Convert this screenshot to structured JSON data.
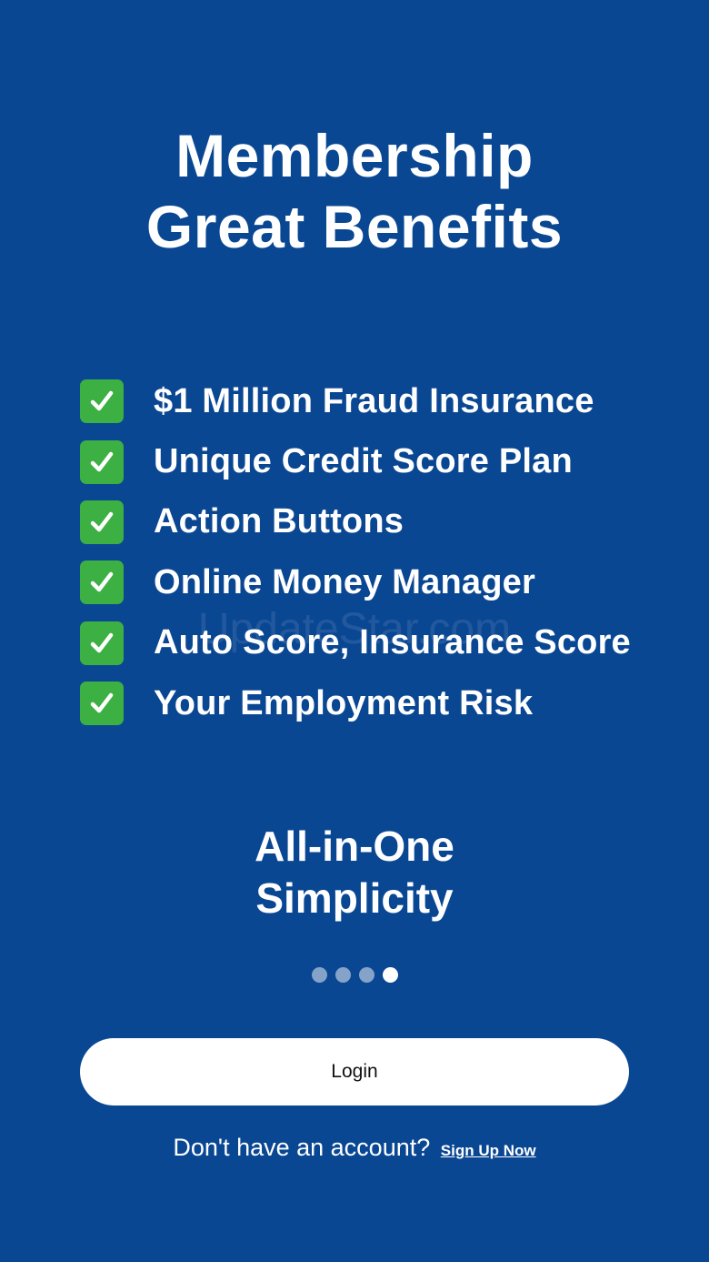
{
  "header": {
    "title_line1": "Membership",
    "title_line2": "Great Benefits"
  },
  "benefits": [
    {
      "label": "$1 Million Fraud Insurance",
      "icon": "check-mark-icon"
    },
    {
      "label": "Unique Credit Score Plan",
      "icon": "check-mark-icon"
    },
    {
      "label": "Action Buttons",
      "icon": "check-mark-icon"
    },
    {
      "label": "Online Money Manager",
      "icon": "check-mark-icon"
    },
    {
      "label": "Auto Score, Insurance Score",
      "icon": "check-mark-icon"
    },
    {
      "label": "Your Employment Risk",
      "icon": "check-mark-icon"
    }
  ],
  "watermark": "UpdateStar.com",
  "tagline": {
    "line1": "All-in-One",
    "line2": "Simplicity"
  },
  "pager": {
    "total": 4,
    "active_index": 3
  },
  "actions": {
    "login_label": "Login",
    "signup_prompt": "Don't have an account?",
    "signup_link": "Sign Up Now"
  },
  "colors": {
    "background": "#0a4793",
    "check_green": "#3cb043",
    "button_bg": "#ffffff",
    "text": "#ffffff"
  }
}
